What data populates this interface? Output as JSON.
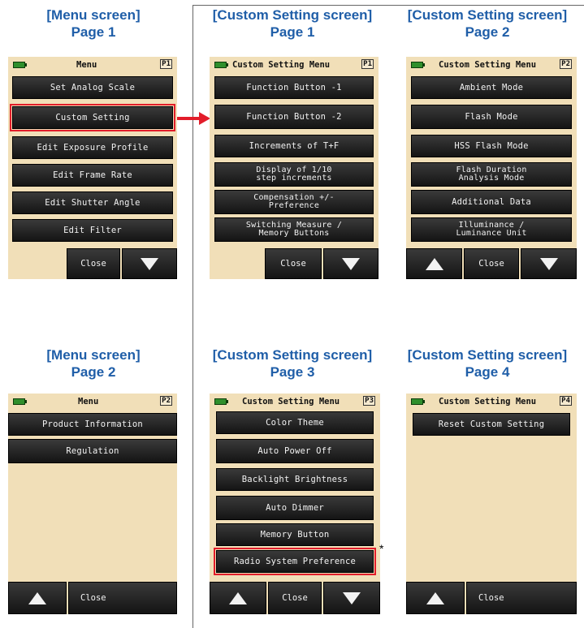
{
  "captions": {
    "menu_p1": [
      "[Menu screen]",
      "Page 1"
    ],
    "cs_p1": [
      "[Custom Setting screen]",
      "Page 1"
    ],
    "cs_p2": [
      "[Custom Setting screen]",
      "Page 2"
    ],
    "menu_p2": [
      "[Menu screen]",
      "Page 2"
    ],
    "cs_p3": [
      "[Custom Setting screen]",
      "Page 3"
    ],
    "cs_p4": [
      "[Custom Setting screen]",
      "Page 4"
    ]
  },
  "screens": {
    "menu_p1": {
      "title": "Menu",
      "page": "P1",
      "items": [
        "Set Analog Scale",
        "Custom Setting",
        "Edit Exposure Profile",
        "Edit Frame Rate",
        "Edit Shutter Angle",
        "Edit Filter"
      ],
      "close": "Close"
    },
    "cs_p1": {
      "title": "Custom Setting Menu",
      "page": "P1",
      "items": [
        "Function Button -1",
        "Function Button -2",
        "Increments of T+F",
        "Display of 1/10\nstep increments",
        "Compensation +/-\nPreference",
        "Switching Measure /\nMemory Buttons"
      ],
      "close": "Close"
    },
    "cs_p2": {
      "title": "Custom Setting Menu",
      "page": "P2",
      "items": [
        "Ambient Mode",
        "Flash Mode",
        "HSS Flash Mode",
        "Flash Duration\nAnalysis Mode",
        "Additional Data",
        "Illuminance /\nLuminance Unit"
      ],
      "close": "Close"
    },
    "menu_p2": {
      "title": "Menu",
      "page": "P2",
      "items": [
        "Product Information",
        "Regulation"
      ],
      "close": "Close"
    },
    "cs_p3": {
      "title": "Custom Setting Menu",
      "page": "P3",
      "items": [
        "Color Theme",
        "Auto Power Off",
        "Backlight Brightness",
        "Auto Dimmer",
        "Memory Button",
        "Radio System Preference"
      ],
      "close": "Close"
    },
    "cs_p4": {
      "title": "Custom Setting Menu",
      "page": "P4",
      "items": [
        "Reset Custom Setting"
      ],
      "close": "Close"
    }
  },
  "asterisk": "*",
  "colors": {
    "caption": "#1f5ea8",
    "highlight": "#e21d2a",
    "screen_bg": "#f1dfb8"
  }
}
